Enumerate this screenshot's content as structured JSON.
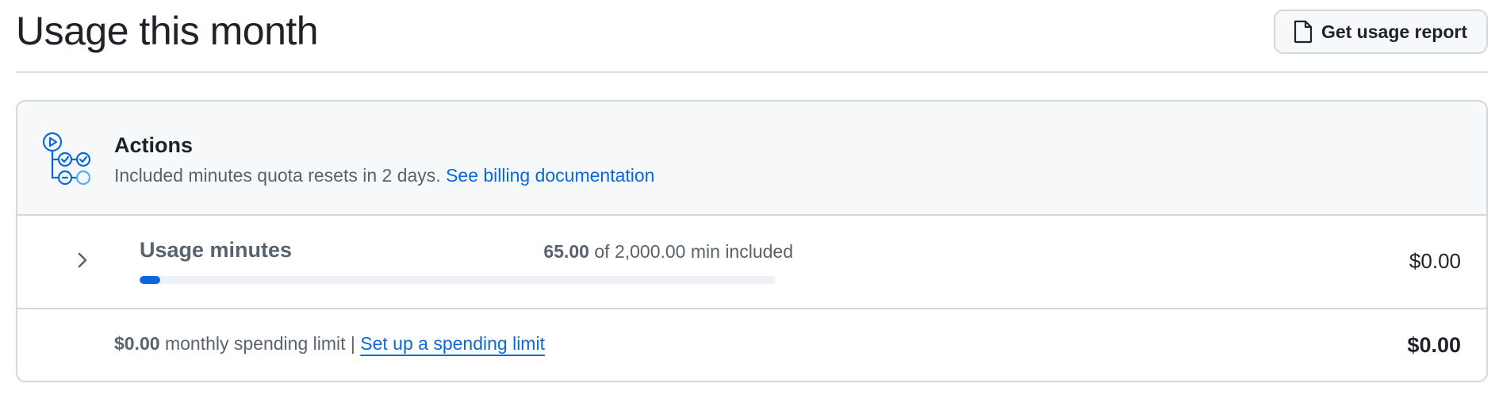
{
  "header": {
    "title": "Usage this month",
    "report_button_label": "Get usage report",
    "report_icon": "file-icon"
  },
  "actions": {
    "title": "Actions",
    "icon": "actions-workflow-icon",
    "subtitle": "Included minutes quota resets in 2 days.",
    "doc_link_label": "See billing documentation"
  },
  "usage": {
    "label": "Usage minutes",
    "used": "65.00",
    "included_text": "of 2,000.00 min included",
    "progress_fraction": 0.0325,
    "cost": "$0.00",
    "chevron_icon": "chevron-right-icon"
  },
  "limit": {
    "amount": "$0.00",
    "text": "monthly spending limit |",
    "link_label": "Set up a spending limit",
    "total": "$0.00"
  },
  "colors": {
    "accent": "#0969da",
    "muted_text": "#59636e",
    "border": "#d1d9e0",
    "header_bg": "#f6f8fa"
  }
}
